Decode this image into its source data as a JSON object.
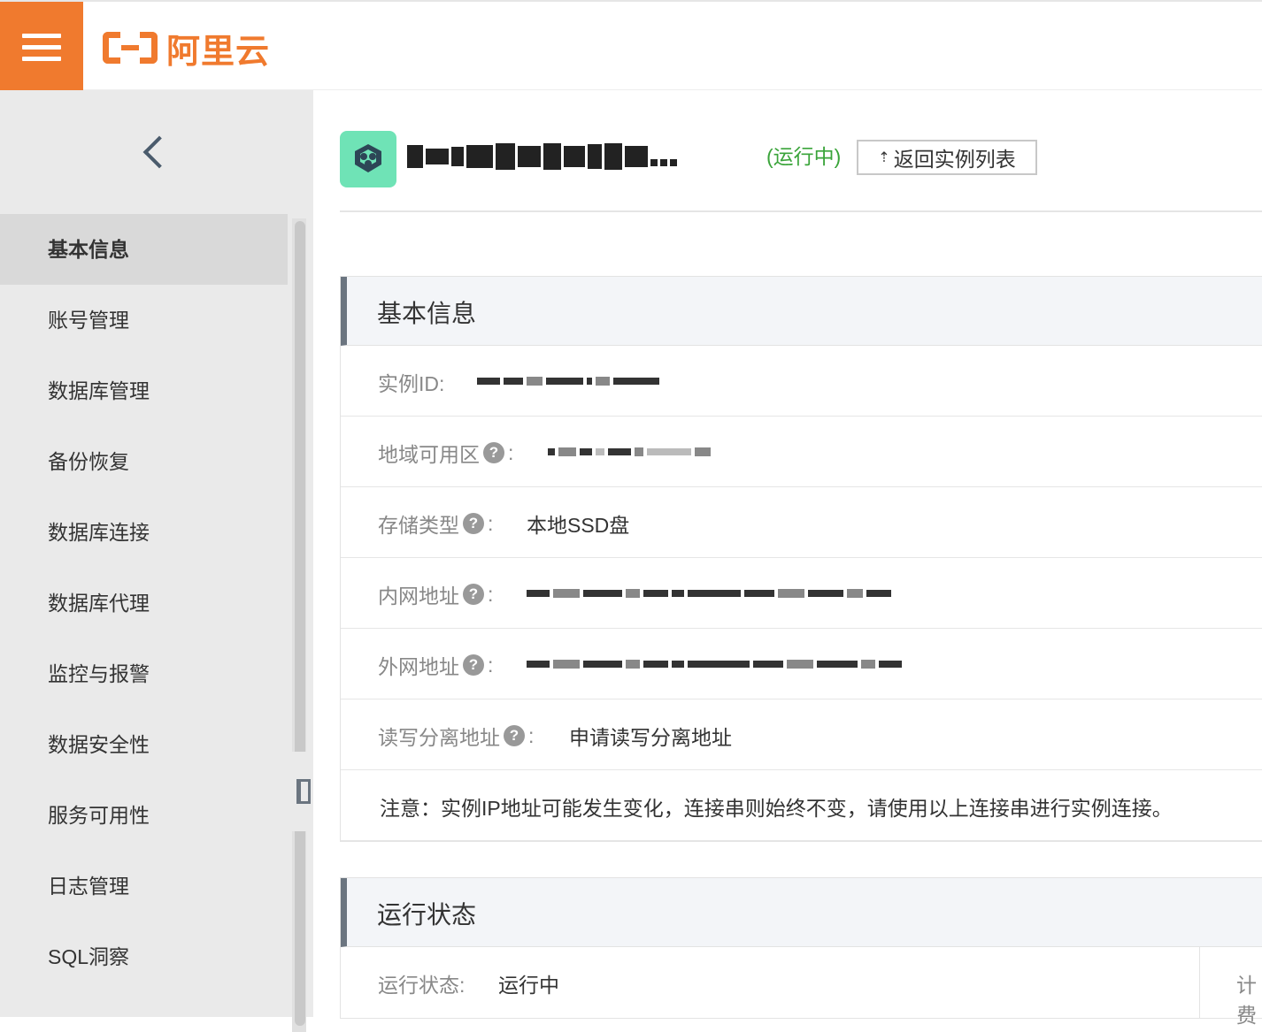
{
  "brand": {
    "logo_text": "阿里云",
    "accent": "#f07a2e"
  },
  "sidebar": {
    "items": [
      {
        "label": "基本信息",
        "active": true
      },
      {
        "label": "账号管理"
      },
      {
        "label": "数据库管理"
      },
      {
        "label": "备份恢复"
      },
      {
        "label": "数据库连接"
      },
      {
        "label": "数据库代理"
      },
      {
        "label": "监控与报警"
      },
      {
        "label": "数据安全性"
      },
      {
        "label": "服务可用性"
      },
      {
        "label": "日志管理"
      },
      {
        "label": "SQL洞察"
      }
    ]
  },
  "header": {
    "status": "(运行中)",
    "back_label": "返回实例列表"
  },
  "basic_info": {
    "title": "基本信息",
    "instance_id_label": "实例ID:",
    "region_label": "地域可用区",
    "storage_label": "存储类型",
    "storage_value": "本地SSD盘",
    "intranet_label": "内网地址",
    "internet_label": "外网地址",
    "rw_label": "读写分离地址",
    "rw_link": "申请读写分离地址",
    "colon": ":",
    "notice": "注意：实例IP地址可能发生变化，连接串则始终不变，请使用以上连接串进行实例连接。"
  },
  "run_state": {
    "title": "运行状态",
    "state_label": "运行状态:",
    "state_value": "运行中",
    "next_col_label": "计费"
  }
}
